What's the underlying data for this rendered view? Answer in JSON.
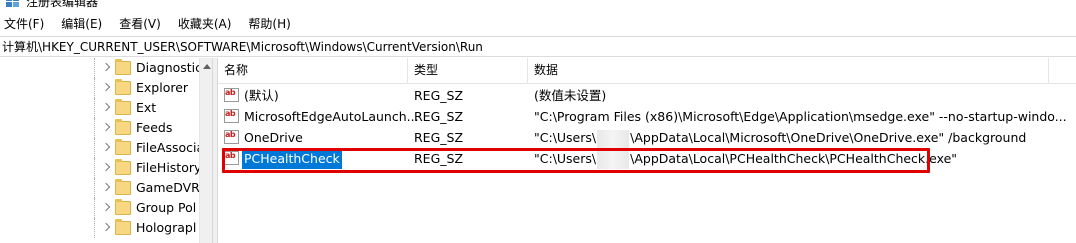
{
  "window": {
    "title": "注册表编辑器"
  },
  "menu": [
    {
      "label": "文件(F)"
    },
    {
      "label": "编辑(E)"
    },
    {
      "label": "查看(V)"
    },
    {
      "label": "收藏夹(A)"
    },
    {
      "label": "帮助(H)"
    }
  ],
  "address": {
    "path": "计算机\\HKEY_CURRENT_USER\\SOFTWARE\\Microsoft\\Windows\\CurrentVersion\\Run"
  },
  "tree": {
    "items": [
      {
        "label": "Diagnostic"
      },
      {
        "label": "Explorer"
      },
      {
        "label": "Ext"
      },
      {
        "label": "Feeds"
      },
      {
        "label": "FileAssocia"
      },
      {
        "label": "FileHistory"
      },
      {
        "label": "GameDVR"
      },
      {
        "label": "Group Pol"
      },
      {
        "label": "Holograpl"
      }
    ]
  },
  "columns": {
    "name": "名称",
    "type": "类型",
    "data": "数据"
  },
  "rows": [
    {
      "name": "(默认)",
      "type": "REG_SZ",
      "data": "(数值未设置)"
    },
    {
      "name": "MicrosoftEdgeAutoLaunch...",
      "type": "REG_SZ",
      "data": "\"C:\\Program Files (x86)\\Microsoft\\Edge\\Application\\msedge.exe\" --no-startup-windo..."
    },
    {
      "name": "OneDrive",
      "type": "REG_SZ",
      "data_prefix": "\"C:\\Users\\",
      "data_suffix": "\\AppData\\Local\\Microsoft\\OneDrive\\OneDrive.exe\" /background"
    },
    {
      "name": "PCHealthCheck",
      "type": "REG_SZ",
      "data_prefix": "\"C:\\Users\\",
      "data_suffix": "\\AppData\\Local\\PCHealthCheck\\PCHealthCheck.exe\""
    }
  ],
  "icons": {
    "app": "registry-editor-icon",
    "value": "reg-string-value-icon",
    "folder": "folder-icon"
  },
  "colors": {
    "selection": "#0078d7",
    "highlight": "#e00000"
  }
}
